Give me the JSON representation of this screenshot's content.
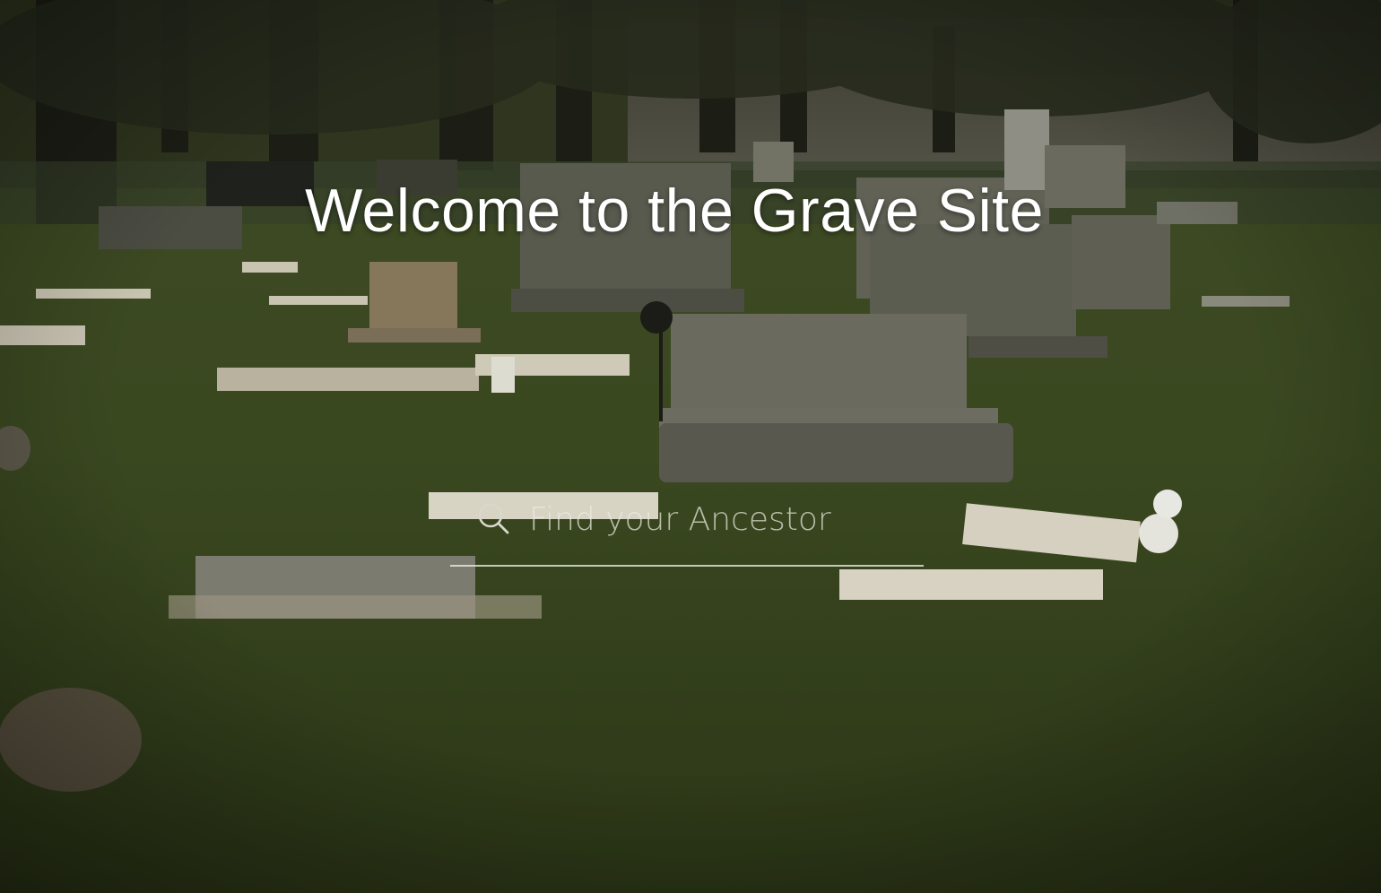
{
  "hero": {
    "title": "Welcome to the Grave Site",
    "background_image": "cemetery-landscape"
  },
  "search": {
    "placeholder": "Find your Ancestor",
    "value": "",
    "icon": "search-icon"
  },
  "colors": {
    "title_text": "#ffffff",
    "search_text": "#e8e8e0",
    "underline": "#ebebe1"
  }
}
